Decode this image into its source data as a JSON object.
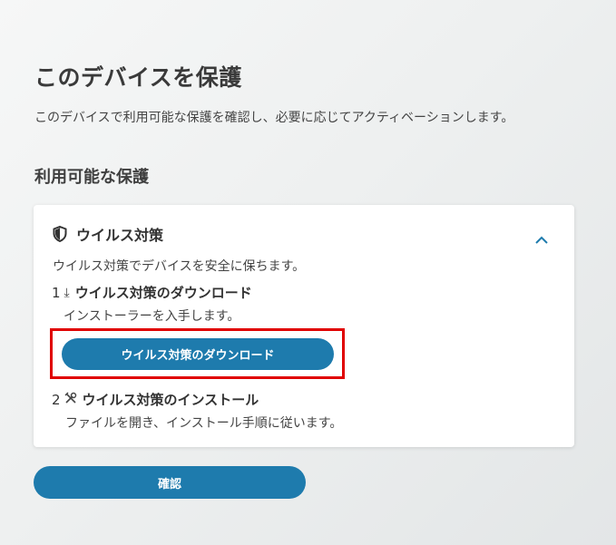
{
  "page": {
    "title": "このデバイスを保護",
    "description": "このデバイスで利用可能な保護を確認し、必要に応じてアクティベーションします。",
    "section_title": "利用可能な保護"
  },
  "card": {
    "title": "ウイルス対策",
    "icon": "shield-icon",
    "description": "ウイルス対策でデバイスを安全に保ちます。",
    "steps": [
      {
        "number": "1",
        "icon": "download-arrow-icon",
        "title": "ウイルス対策のダウンロード",
        "subtitle": "インストーラーを入手します。",
        "button_label": "ウイルス対策のダウンロード"
      },
      {
        "number": "2",
        "icon": "tools-icon",
        "title": "ウイルス対策のインストール",
        "subtitle": "ファイルを開き、インストール手順に従います。"
      }
    ]
  },
  "footer": {
    "confirm_label": "確認"
  },
  "colors": {
    "accent": "#1e7bad",
    "highlight": "#e00000"
  }
}
